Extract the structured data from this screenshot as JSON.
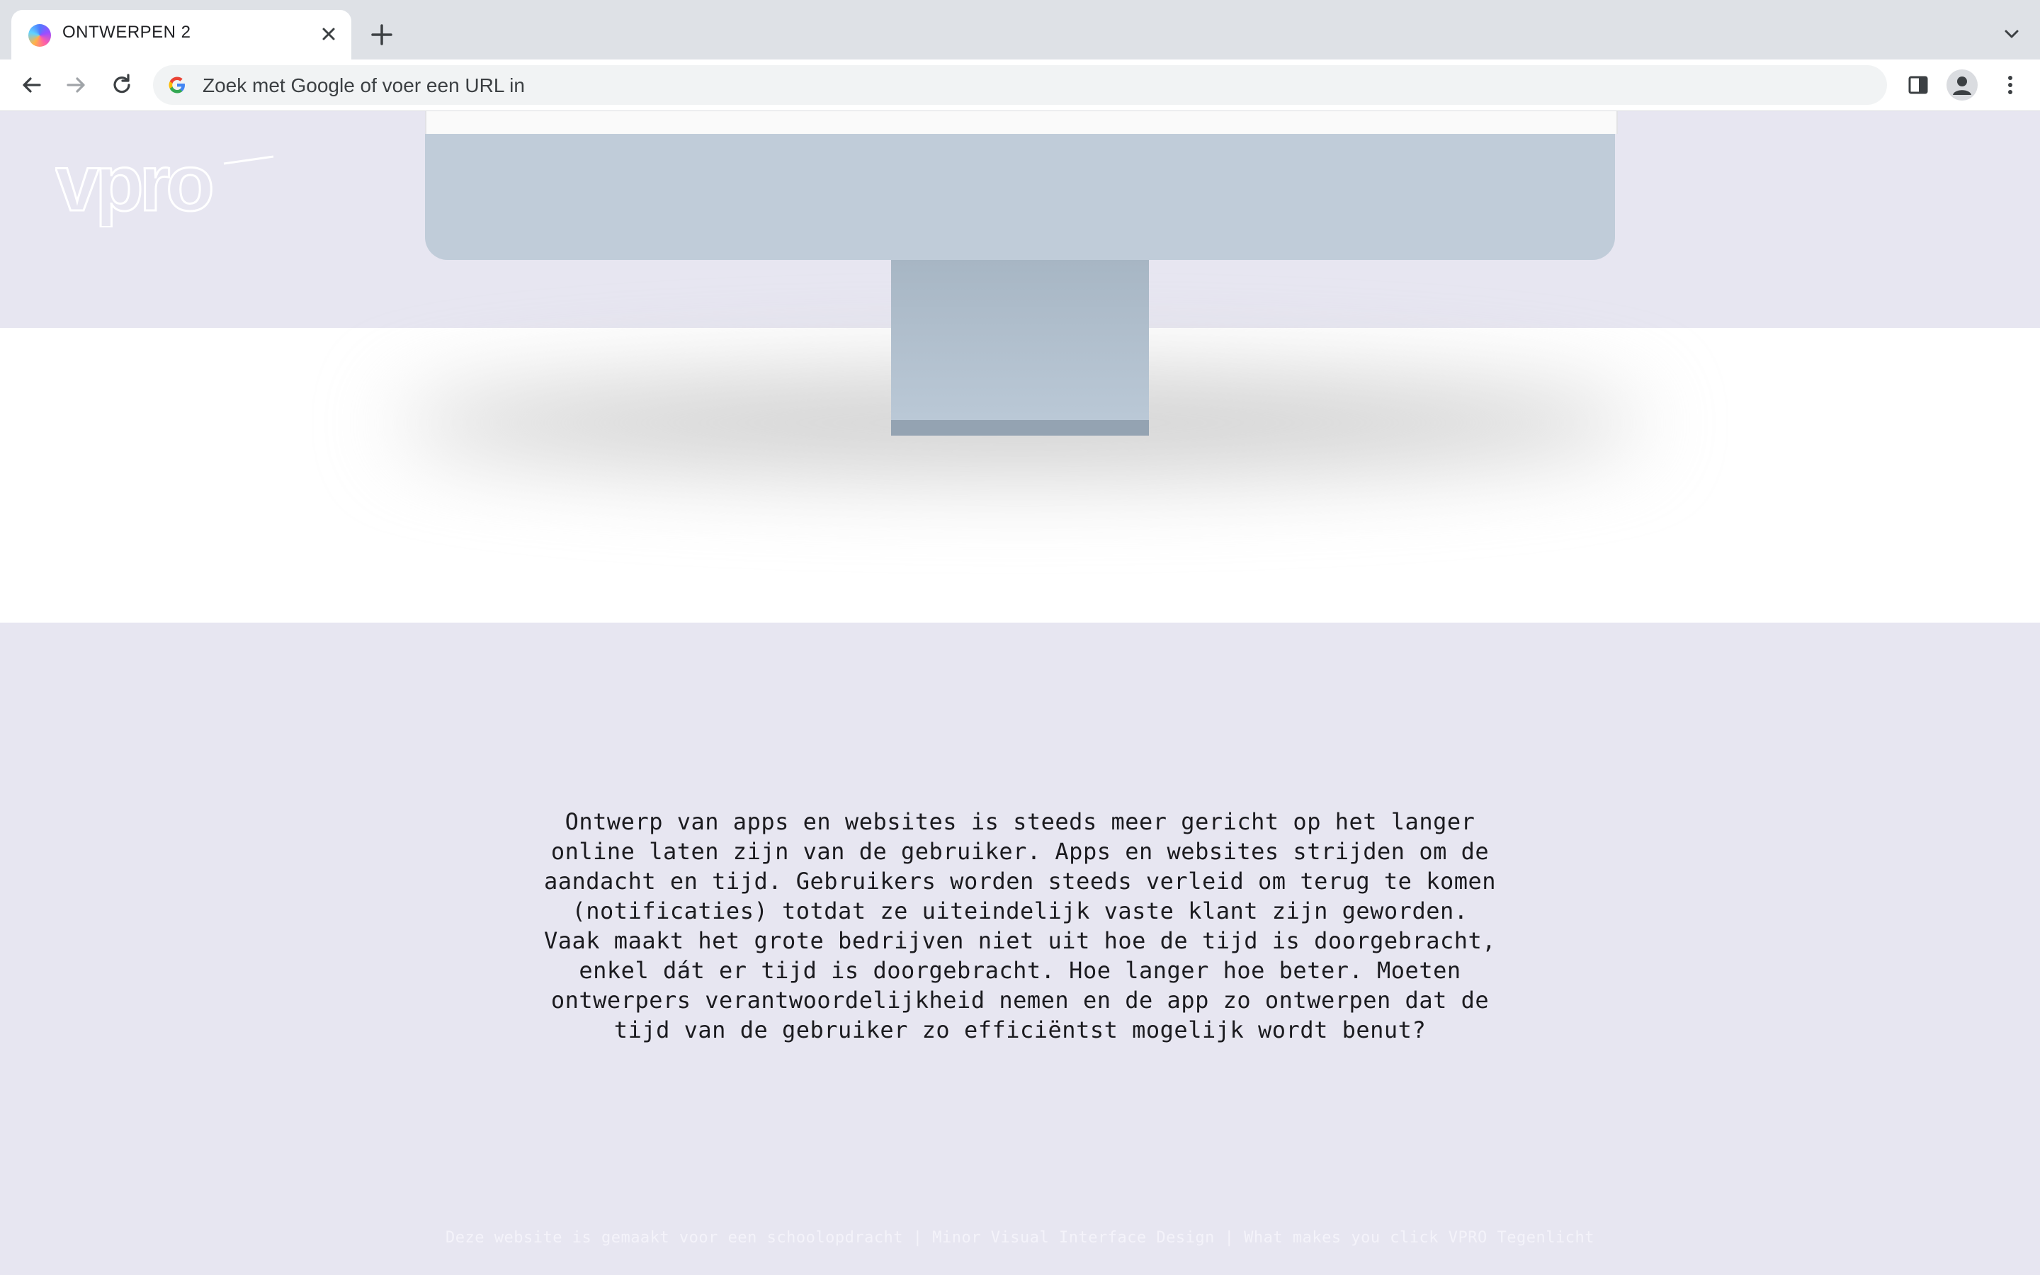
{
  "browser": {
    "tab": {
      "title": "ONTWERPEN 2"
    },
    "omnibox": {
      "placeholder": "Zoek met Google of voer een URL in"
    }
  },
  "page": {
    "logo_text": "vpro",
    "body": "Ontwerp van apps en websites is steeds meer gericht op het langer online laten zijn van de gebruiker. Apps en websites strijden om de aandacht en tijd. Gebruikers worden steeds verleid om terug te komen (notificaties) totdat ze uiteindelijk vaste klant zijn geworden. Vaak maakt het grote bedrijven niet uit hoe de tijd is doorgebracht, enkel dát er tijd is doorgebracht. Hoe langer hoe beter. Moeten ontwerpers verantwoordelijkheid nemen en de app zo ontwerpen dat de tijd van de gebruiker zo efficiëntst mogelijk wordt benut?",
    "footer": "Deze website is gemaakt voor een schoolopdracht | Minor Visual Interface Design | What makes you click VPRO Tegenlicht"
  },
  "colors": {
    "page_background": "#e7e6f1",
    "monitor": "#c0ccd9",
    "stand": "#a7b6c4"
  }
}
